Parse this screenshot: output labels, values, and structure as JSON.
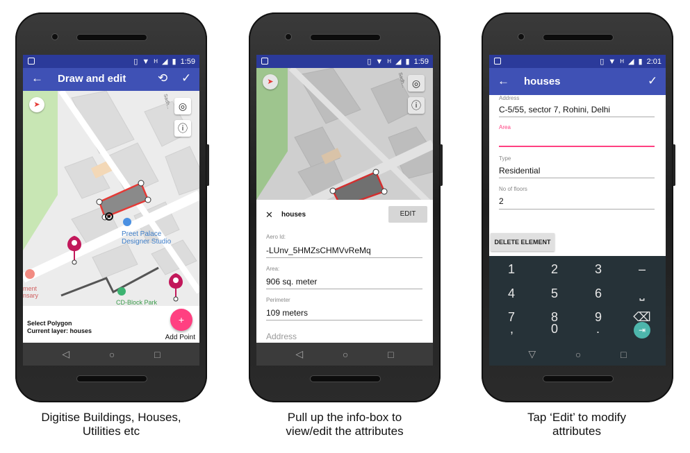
{
  "phones": [
    {
      "status": {
        "time": "1:59",
        "h": "H"
      },
      "appbar": {
        "title": "Draw and edit",
        "back": "←",
        "undo": "⟲",
        "done": "✓"
      },
      "map": {
        "poi_line1": "Preet Palace",
        "poi_line2": "Designer Studio",
        "road": "Sadh...",
        "left_poi_1": "ment",
        "left_poi_2": "nsary",
        "park": "CD-Block Park"
      },
      "panel": {
        "select_polygon": "Select Polygon",
        "current_layer": "Current layer: houses",
        "fab": "+",
        "fab_label": "Add Point"
      }
    },
    {
      "status": {
        "time": "1:59",
        "h": "H"
      },
      "map": {
        "road": "Sadh..."
      },
      "info": {
        "close": "✕",
        "title": "houses",
        "edit": "EDIT",
        "fields": [
          {
            "label": "Aero Id:",
            "value": "-LUnv_5HMZsCHMVvReMq"
          },
          {
            "label": "Area:",
            "value": "906 sq. meter"
          },
          {
            "label": "Perimeter",
            "value": "109 meters"
          }
        ],
        "address_label": "Address"
      }
    },
    {
      "status": {
        "time": "2:01",
        "h": "H"
      },
      "appbar": {
        "title": "houses",
        "back": "←",
        "done": "✓"
      },
      "form": {
        "address_label": "Address",
        "address_value": "C-5/55, sector 7, Rohini, Delhi",
        "area_label": "Area",
        "type_label": "Type",
        "type_value": "Residential",
        "floors_label": "No of floors",
        "floors_value": "2",
        "delete": "DELETE ELEMENT"
      },
      "keypad": {
        "keys": [
          "1",
          "2",
          "3",
          "–",
          "4",
          "5",
          "6",
          "⎵",
          "7",
          "8",
          "9",
          "⌫",
          ",",
          "0",
          ".",
          "⇥"
        ]
      }
    }
  ],
  "captions": [
    {
      "line1": "Digitise Buildings, Houses,",
      "line2": "Utilities etc"
    },
    {
      "line1": "Pull up the info-box to",
      "line2": "view/edit the attributes"
    },
    {
      "line1": "Tap ‘Edit’ to modify",
      "line2": "attributes"
    }
  ],
  "colors": {
    "statusbar": "#2b3a9a",
    "appbar": "#3f51b5",
    "fab": "#ff4081",
    "polygon_stroke": "#e53935",
    "marker": "#c2185b",
    "keypad": "#263238",
    "accent_teal": "#4db6ac"
  },
  "icons": {
    "locate": "◎",
    "info": "ⓘ",
    "nav_back": "◁",
    "nav_home": "○",
    "nav_recent": "□"
  }
}
